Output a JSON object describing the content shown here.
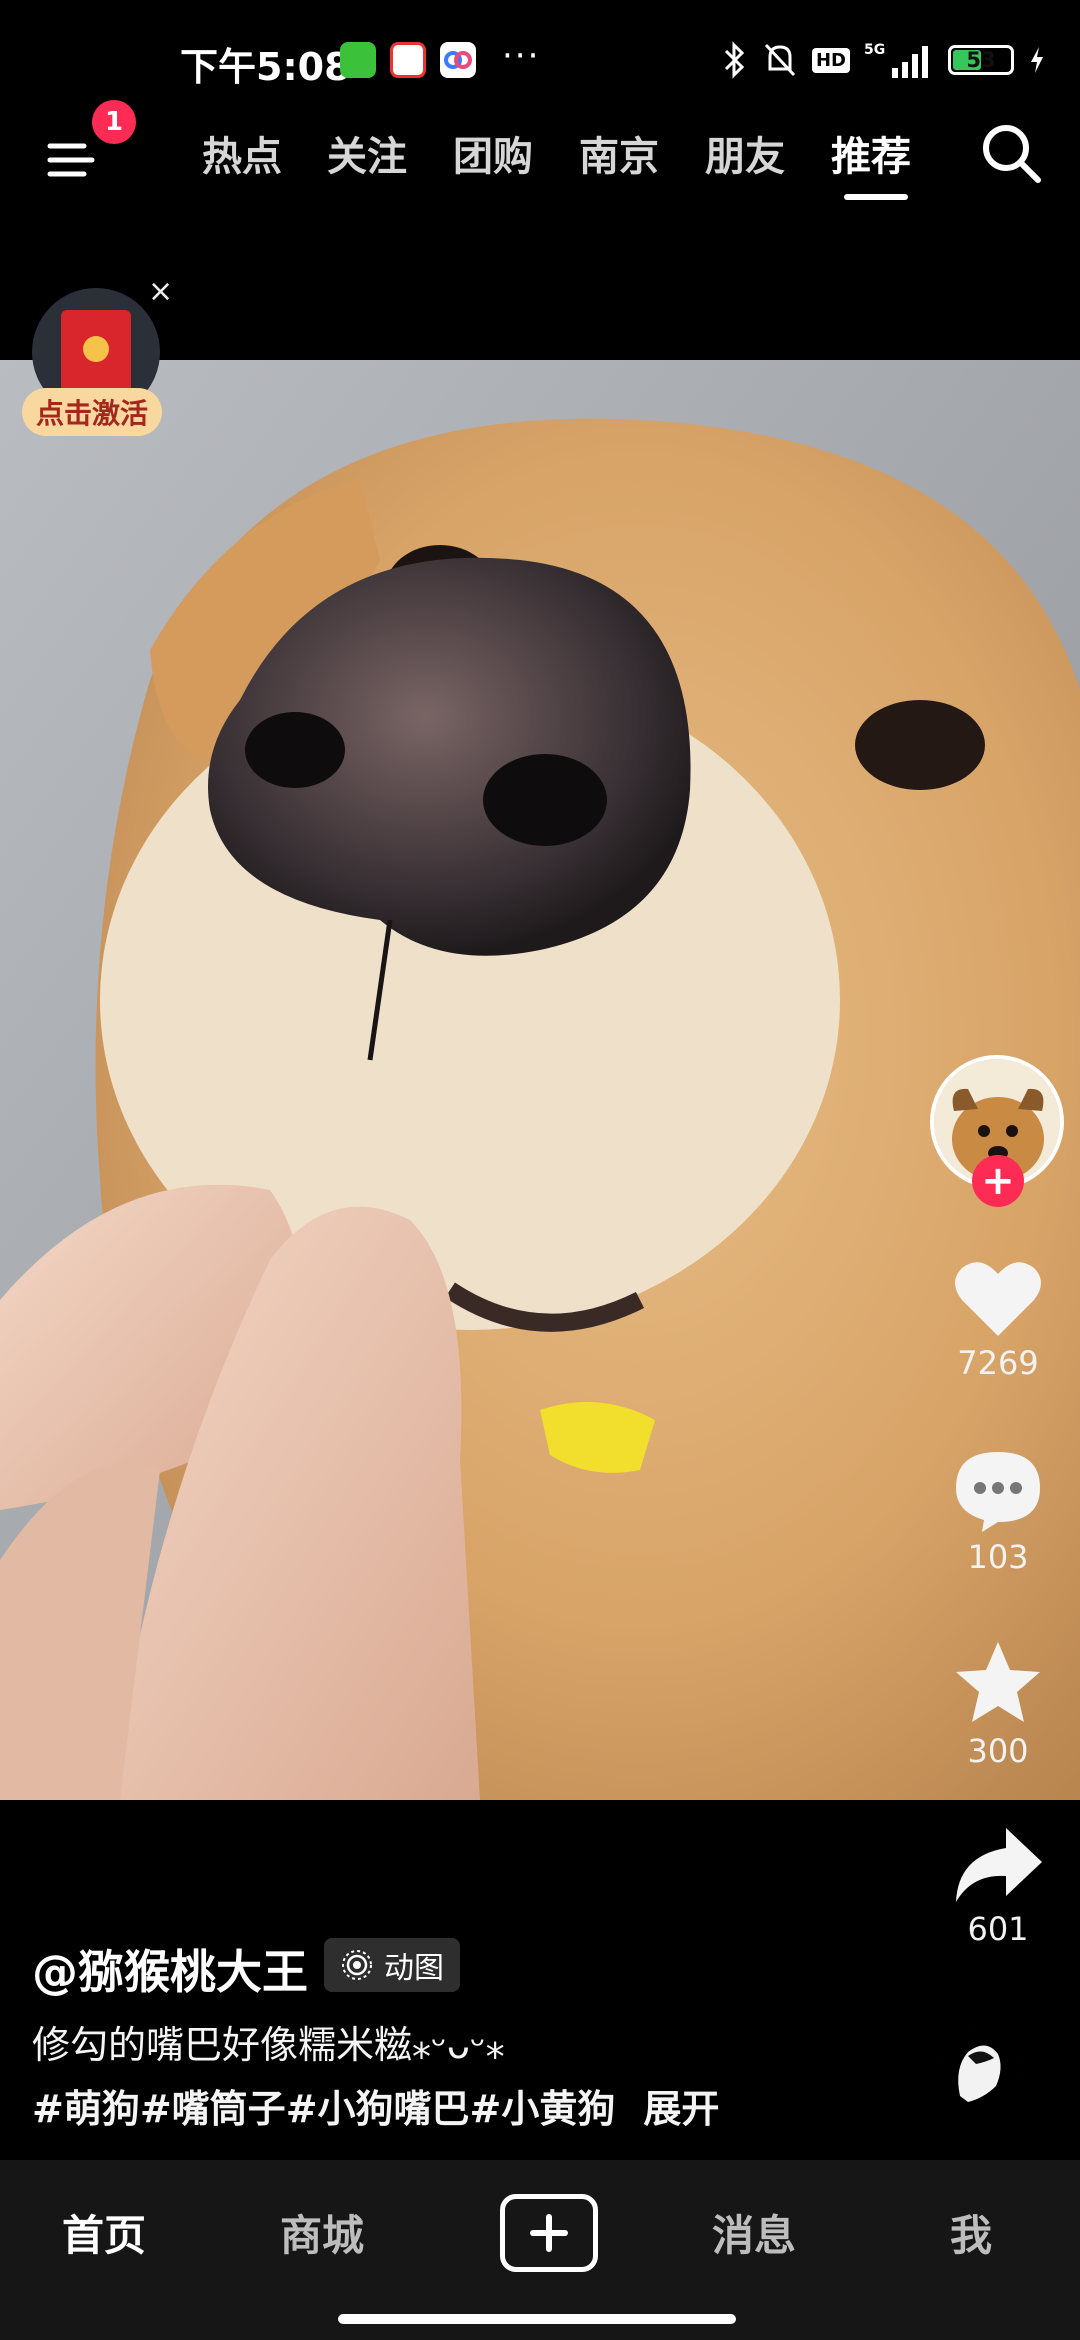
{
  "status_bar": {
    "time": "下午5:08",
    "more": "···",
    "network": "5G",
    "hd": "HD",
    "battery": "53",
    "battery_percent": 53
  },
  "top_nav": {
    "menu_badge": "1",
    "tabs": [
      "热点",
      "关注",
      "团购",
      "南京",
      "朋友",
      "推荐"
    ],
    "active_tab": "推荐"
  },
  "red_packet": {
    "label": "点击激活",
    "close": "×"
  },
  "sidebar": {
    "like_count": "7269",
    "comment_count": "103",
    "favorite_count": "300",
    "share_count": "601",
    "follow": "+"
  },
  "post": {
    "author": "@猕猴桃大王",
    "badge": "动图",
    "description": "修勾的嘴巴好像糯米糍⁎ᵕᴗᵕ⁎",
    "tags": [
      "#萌狗",
      "#嘴筒子",
      "#小狗嘴巴",
      "#小黄狗"
    ],
    "expand": "展开"
  },
  "bottom_nav": {
    "items": [
      "首页",
      "商城",
      "消息",
      "我"
    ],
    "active": "首页"
  },
  "colors": {
    "accent": "#fe2c55",
    "background": "#000000",
    "bottom_bar": "#161616",
    "battery": "#35c759"
  }
}
